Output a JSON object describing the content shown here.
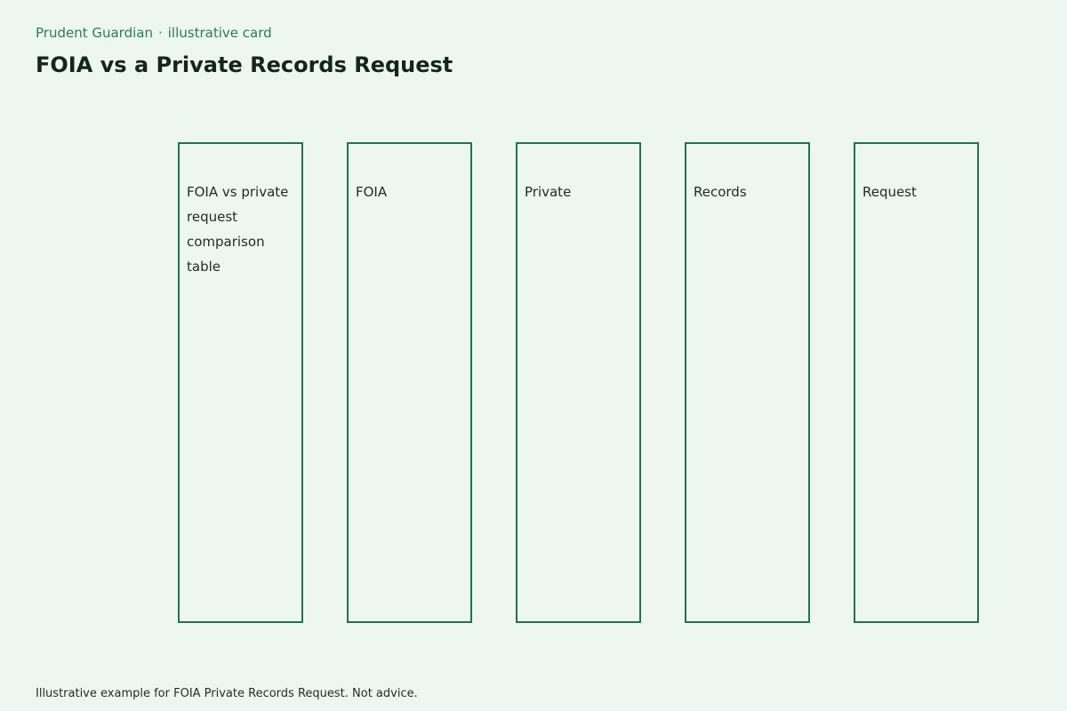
{
  "header": {
    "brand": "Prudent Guardian",
    "separator": "·",
    "tag": "illustrative card",
    "title": "FOIA vs a Private Records Request"
  },
  "columns": [
    {
      "label": "FOIA vs private request comparison table"
    },
    {
      "label": "FOIA"
    },
    {
      "label": "Private"
    },
    {
      "label": "Records"
    },
    {
      "label": "Request"
    }
  ],
  "footer": {
    "note": "Illustrative example for FOIA Private Records Request. Not advice."
  },
  "colors": {
    "background": "#eef6f1",
    "accent": "#23705a",
    "brand_text": "#2a7a5e"
  }
}
